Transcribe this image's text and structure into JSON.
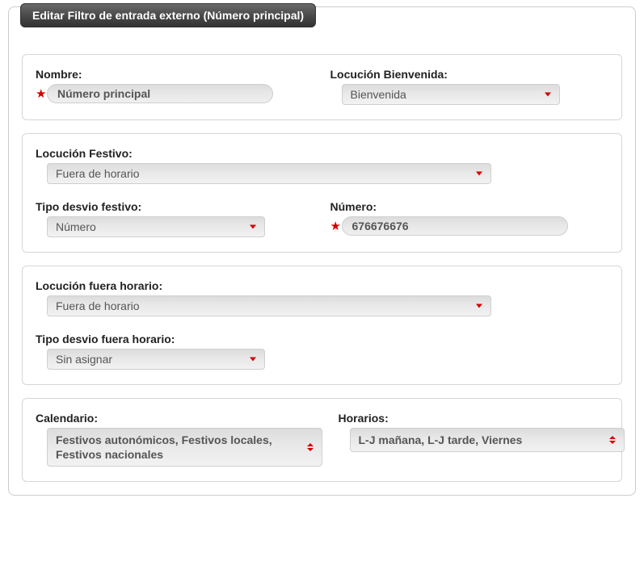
{
  "title": "Editar Filtro de entrada externo (Número principal)",
  "panel1": {
    "nombre": {
      "label": "Nombre:",
      "value": "Número principal"
    },
    "locucion_bienvenida": {
      "label": "Locución Bienvenida:",
      "value": "Bienvenida"
    }
  },
  "panel2": {
    "locucion_festivo": {
      "label": "Locución Festivo:",
      "value": "Fuera de horario"
    },
    "tipo_desvio_festivo": {
      "label": "Tipo desvio festivo:",
      "value": "Número"
    },
    "numero": {
      "label": "Número:",
      "value": "676676676"
    }
  },
  "panel3": {
    "locucion_fuera_horario": {
      "label": "Locución fuera horario:",
      "value": "Fuera de horario"
    },
    "tipo_desvio_fuera_horario": {
      "label": "Tipo desvio fuera horario:",
      "value": "Sin asignar"
    }
  },
  "panel4": {
    "calendario": {
      "label": "Calendario:",
      "value": "Festivos autonómicos, Festivos locales, Festivos nacionales"
    },
    "horarios": {
      "label": "Horarios:",
      "value": "L-J mañana, L-J tarde, Viernes"
    }
  }
}
